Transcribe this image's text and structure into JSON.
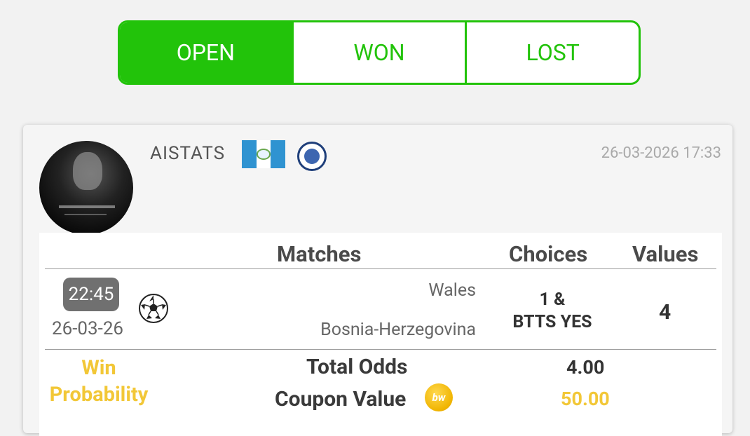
{
  "tabs": [
    {
      "label": "OPEN",
      "active": true
    },
    {
      "label": "WON",
      "active": false
    },
    {
      "label": "LOST",
      "active": false
    }
  ],
  "post": {
    "username": "AISTATS",
    "flag_icon": "guatemala-flag-icon",
    "club_icon": "adana-demirspor-crest-icon",
    "datetime": "26-03-2026 17:33"
  },
  "table": {
    "headers": {
      "matches": "Matches",
      "choices": "Choices",
      "values": "Values"
    },
    "row": {
      "time": "22:45",
      "date": "26-03-26",
      "sport_icon": "soccer-ball-icon",
      "home_team": "Wales",
      "away_team": "Bosnia-Herzegovina",
      "choice_line1": "1 &",
      "choice_line2": "BTTS YES",
      "value": "4"
    },
    "footer": {
      "win_prob_line1": "Win",
      "win_prob_line2": "Probability",
      "total_odds_label": "Total Odds",
      "total_odds": "4.00",
      "coupon_value_label": "Coupon Value",
      "coin_label": "bw",
      "coupon_value": "50.00"
    }
  },
  "colors": {
    "accent": "#22c30a",
    "gold": "#f2c737"
  }
}
